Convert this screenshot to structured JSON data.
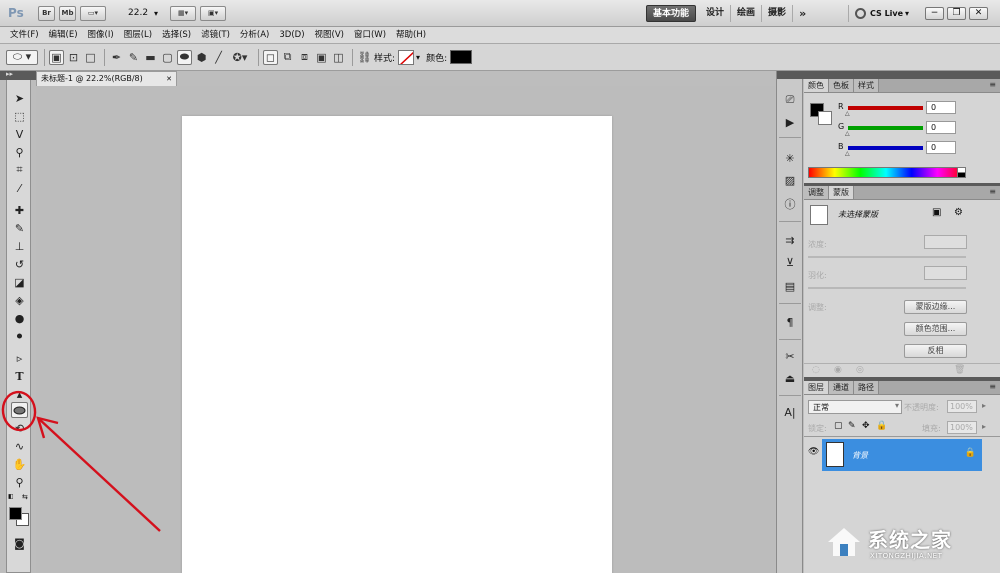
{
  "app": {
    "logo": "Ps",
    "zoom_value": "22.2"
  },
  "top": {
    "app_buttons": [
      "Br",
      "Mb"
    ],
    "workspaces": [
      "基本功能",
      "设计",
      "绘画",
      "摄影"
    ],
    "more": "»",
    "cslive": "CS Live",
    "cslive_arrow": "▾",
    "window_buttons": {
      "minimize": "−",
      "restore": "❐",
      "close": "✕"
    }
  },
  "menu": [
    "文件(F)",
    "编辑(E)",
    "图像(I)",
    "图层(L)",
    "选择(S)",
    "滤镜(T)",
    "分析(A)",
    "3D(D)",
    "视图(V)",
    "窗口(W)",
    "帮助(H)"
  ],
  "options": {
    "style_label": "样式:",
    "color_label": "颜色:",
    "color_value": "#000000"
  },
  "document": {
    "tab_title": "未标题-1 @ 22.2%(RGB/8)",
    "close": "✕",
    "canvas_color": "#ffffff"
  },
  "tools": {
    "foreground": "#000000",
    "background": "#ffffff",
    "selected": "ellipse-tool",
    "type_glyph": "T",
    "selected_name": "ellipse-tool"
  },
  "color_panel": {
    "tabs": [
      "颜色",
      "色板",
      "样式"
    ],
    "channels": [
      {
        "label": "R",
        "value": "0",
        "bar": "#c00000"
      },
      {
        "label": "G",
        "value": "0",
        "bar": "#00a000"
      },
      {
        "label": "B",
        "value": "0",
        "bar": "#0000c0"
      }
    ]
  },
  "masks_panel": {
    "tabs": [
      "调整",
      "蒙版"
    ],
    "no_mask": "未选择蒙版",
    "density": "浓度:",
    "feather": "羽化:",
    "refine": "调整:",
    "buttons": [
      "蒙版边缘...",
      "颜色范围...",
      "反相"
    ]
  },
  "layers_panel": {
    "tabs": [
      "图层",
      "通道",
      "路径"
    ],
    "blend_mode": "正常",
    "opacity_label": "不透明度:",
    "opacity": "100%",
    "lock_label": "锁定:",
    "fill_label": "填充:",
    "fill": "100%",
    "layer_name": "背景",
    "highlight": "#3b8ee0"
  },
  "accent": {
    "annotation": "#d4101c"
  },
  "watermark": {
    "text": "系统之家",
    "url": "XITONGZHIJIA.NET"
  }
}
